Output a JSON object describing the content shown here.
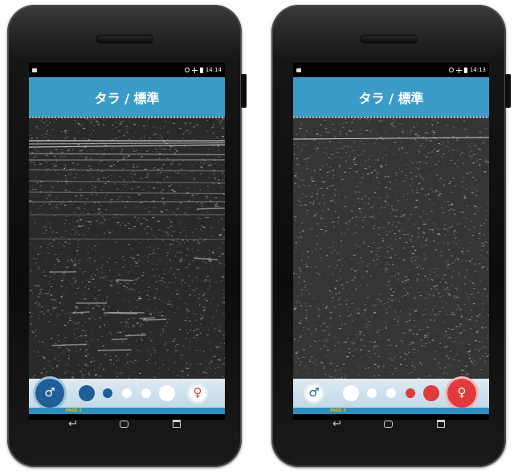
{
  "phones": [
    {
      "status": {
        "time": "14:14"
      },
      "title": "タラ / 標準",
      "page_label": "PAGE 2",
      "scan_style": "layered",
      "selector": [
        {
          "icon": "male-symbol-icon",
          "symbol": "♂",
          "color": "#1f5f95",
          "selected": true,
          "size": "xl"
        },
        {
          "icon": "dot",
          "color": "#1f5f95",
          "size": "m"
        },
        {
          "icon": "dot",
          "color": "#1f5f95",
          "size": "s"
        },
        {
          "icon": "dot",
          "color": "#ffffff",
          "size": "s"
        },
        {
          "icon": "dot",
          "color": "#ffffff",
          "size": "s"
        },
        {
          "icon": "dot",
          "color": "#ffffff",
          "size": "m"
        },
        {
          "icon": "female-symbol-icon",
          "symbol": "♀",
          "color": "#ffffff",
          "size": "l"
        }
      ]
    },
    {
      "status": {
        "time": "14:13"
      },
      "title": "タラ / 標準",
      "page_label": "PAGE 2",
      "scan_style": "diffuse",
      "selector": [
        {
          "icon": "male-symbol-icon",
          "symbol": "♂",
          "color": "#ffffff",
          "size": "l"
        },
        {
          "icon": "dot",
          "color": "#ffffff",
          "size": "m"
        },
        {
          "icon": "dot",
          "color": "#ffffff",
          "size": "s"
        },
        {
          "icon": "dot",
          "color": "#ffffff",
          "size": "s"
        },
        {
          "icon": "dot",
          "color": "#e03a3a",
          "size": "s"
        },
        {
          "icon": "dot",
          "color": "#e03a3a",
          "size": "m"
        },
        {
          "icon": "female-symbol-icon",
          "symbol": "♀",
          "color": "#e03a3a",
          "selected": true,
          "size": "xl"
        }
      ]
    }
  ]
}
